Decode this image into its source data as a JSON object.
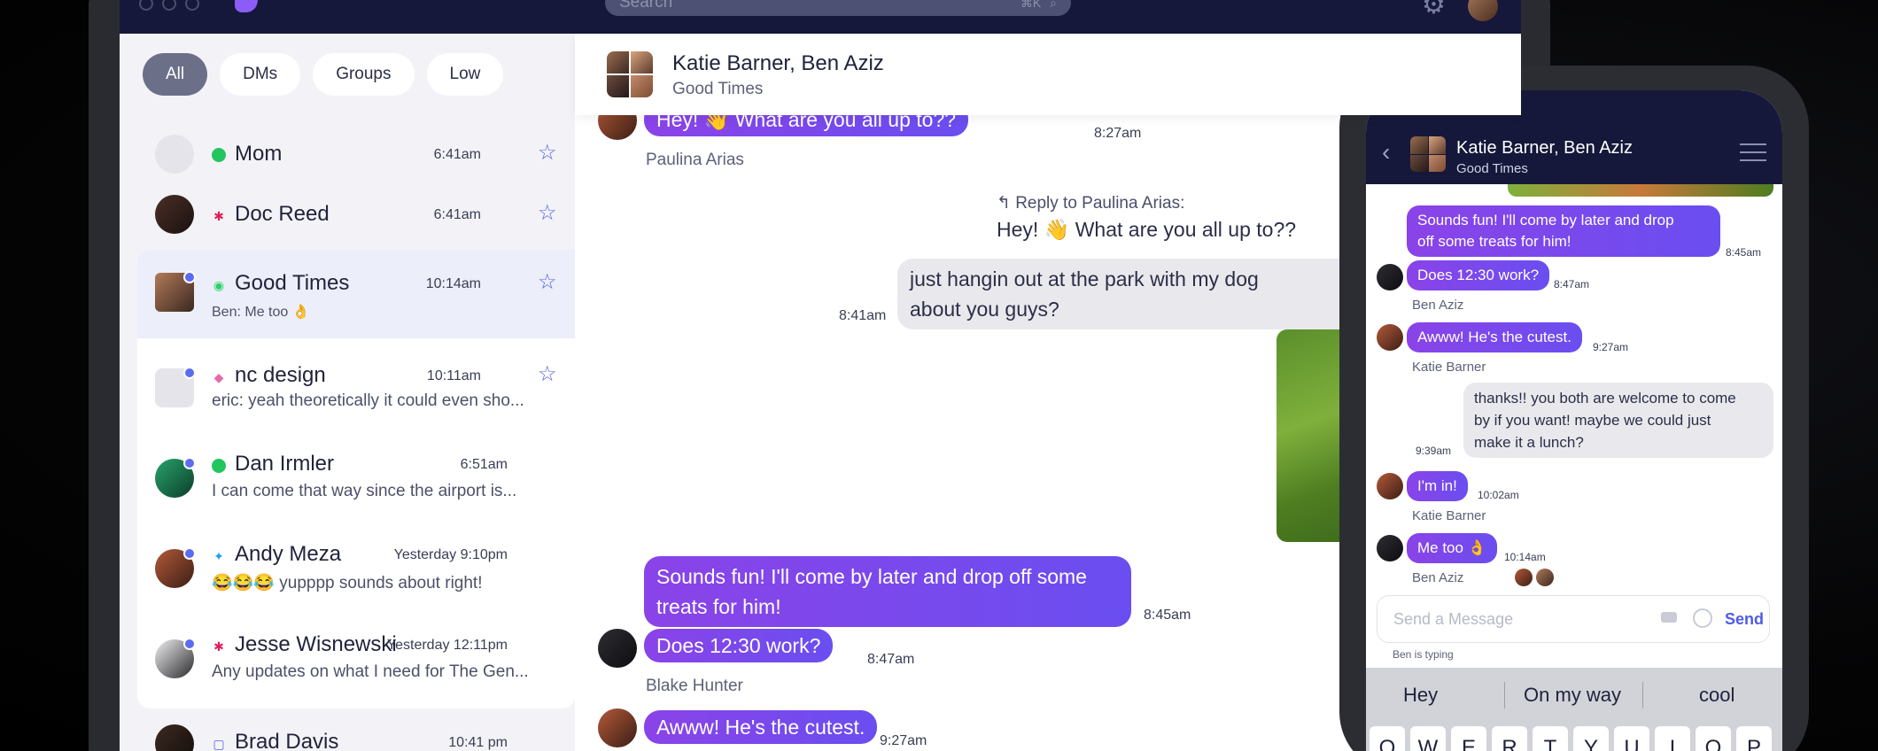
{
  "search": {
    "placeholder": "Search",
    "shortcut": "⌘K"
  },
  "filters": [
    "All",
    "DMs",
    "Groups",
    "Low"
  ],
  "conversations": [
    {
      "name": "Mom",
      "time": "6:41am",
      "network": "online-dot",
      "preview": ""
    },
    {
      "name": "Doc Reed",
      "time": "6:41am",
      "network": "slack-icon",
      "preview": ""
    },
    {
      "name": "Good Times",
      "time": "10:14am",
      "network": "whatsapp-icon",
      "preview": "Ben: Me too 👌"
    },
    {
      "name": "nc design",
      "time": "10:11am",
      "network": "figma-icon",
      "preview": "eric: yeah theoretically it could even sho..."
    },
    {
      "name": "Dan Irmler",
      "time": "6:51am",
      "network": "online-dot",
      "preview": "I can come that way since the airport is..."
    },
    {
      "name": "Andy Meza",
      "time": "Yesterday 9:10pm",
      "network": "twitter-icon",
      "preview": "😂😂😂 yupppp sounds about right!"
    },
    {
      "name": "Jesse Wisnewski",
      "time": "Yesterday 12:11pm",
      "network": "slack-icon",
      "preview": "Any updates on what I need for The Gen..."
    },
    {
      "name": "Brad Davis",
      "time": "10:41 pm",
      "network": "chat-icon",
      "preview": ""
    }
  ],
  "chat": {
    "title": "Katie Barner, Ben Aziz",
    "subtitle": "Good Times",
    "messages": [
      {
        "text": "Hey! 👋 What are you all up to??",
        "time": "8:27am",
        "sender": "Paulina Arias"
      },
      {
        "reply_label": "Reply to Paulina Arias:",
        "reply_text": "Hey! 👋 What are you all up to??"
      },
      {
        "text_line1": "just hangin out at the park with my dog",
        "text_line2": "about you guys?",
        "time": "8:41am"
      },
      {
        "text_line1": "Sounds fun! I'll come by later and drop off some",
        "text_line2": "treats for him!",
        "time": "8:45am"
      },
      {
        "text": "Does 12:30 work?",
        "time": "8:47am",
        "sender": "Blake Hunter"
      },
      {
        "text": "Awww! He's the cutest.",
        "time": "9:27am"
      }
    ]
  },
  "phone": {
    "title": "Katie Barner, Ben Aziz",
    "subtitle": "Good Times",
    "messages": [
      {
        "text_line1": "Sounds fun! I'll come by later and drop",
        "text_line2": "off some treats for him!",
        "time": "8:45am"
      },
      {
        "text": "Does 12:30 work?",
        "time": "8:47am",
        "sender": "Ben Aziz"
      },
      {
        "text": "Awww! He's the cutest.",
        "time": "9:27am",
        "sender": "Katie Barner"
      },
      {
        "text_line1": "thanks!! you both are welcome to come",
        "text_line2": "by if you want! maybe we could just",
        "text_line3": "make it a lunch?",
        "time": "9:39am"
      },
      {
        "text": "I'm in!",
        "time": "10:02am",
        "sender": "Katie Barner"
      },
      {
        "text": "Me too 👌",
        "time": "10:14am",
        "sender": "Ben Aziz"
      }
    ],
    "input_placeholder": "Send a Message",
    "send_label": "Send",
    "typing": "Ben is typing",
    "suggestions": [
      "Hey",
      "On my way",
      "cool"
    ],
    "keys": [
      "Q",
      "W",
      "E",
      "R",
      "T",
      "Y",
      "U",
      "I",
      "O",
      "P"
    ]
  },
  "colors": {
    "accent": "#6a4ef0",
    "navy": "#15183a"
  }
}
